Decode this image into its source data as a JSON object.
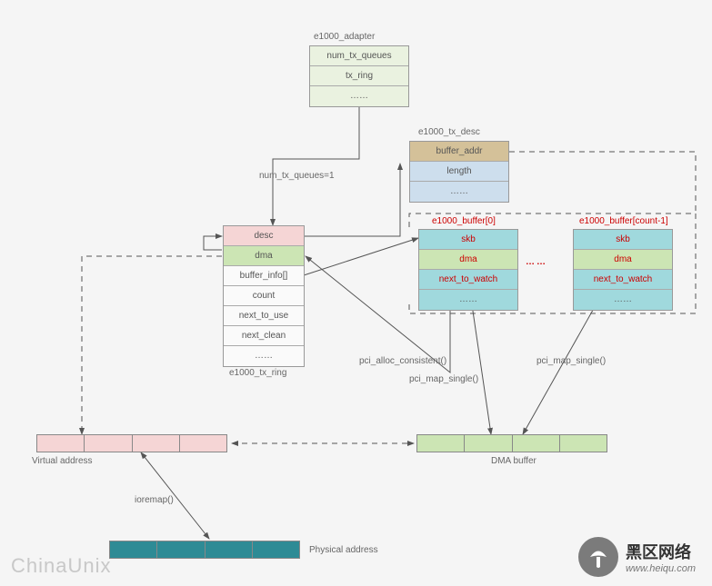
{
  "adapter": {
    "title": "e1000_adapter",
    "f1": "num_tx_queues",
    "f2": "tx_ring",
    "f3": "……"
  },
  "edge_ntq": "num_tx_queues=1",
  "tx_ring": {
    "title": "e1000_tx_ring",
    "f1": "desc",
    "f2": "dma",
    "f3": "buffer_info[]",
    "f4": "count",
    "f5": "next_to_use",
    "f6": "next_clean",
    "f7": "……"
  },
  "tx_desc": {
    "title": "e1000_tx_desc",
    "f1": "buffer_addr",
    "f2": "length",
    "f3": "……"
  },
  "buf0": {
    "title": "e1000_buffer[0]",
    "f1": "skb",
    "f2": "dma",
    "f3": "next_to_watch",
    "f4": "……"
  },
  "bufN": {
    "title": "e1000_buffer[count-1]",
    "f1": "skb",
    "f2": "dma",
    "f3": "next_to_watch",
    "f4": "……"
  },
  "buf_dots": "……",
  "fn_alloc": "pci_alloc_consistent()",
  "fn_map1": "pci_map_single()",
  "fn_map2": "pci_map_single()",
  "fn_iorem": "ioremap()",
  "va_label": "Virtual address",
  "pa_label": "Physical address",
  "dma_label": "DMA buffer",
  "watermark": "ChinaUnix",
  "site": {
    "name": "黑区网络",
    "url": "www.heiqu.com"
  }
}
